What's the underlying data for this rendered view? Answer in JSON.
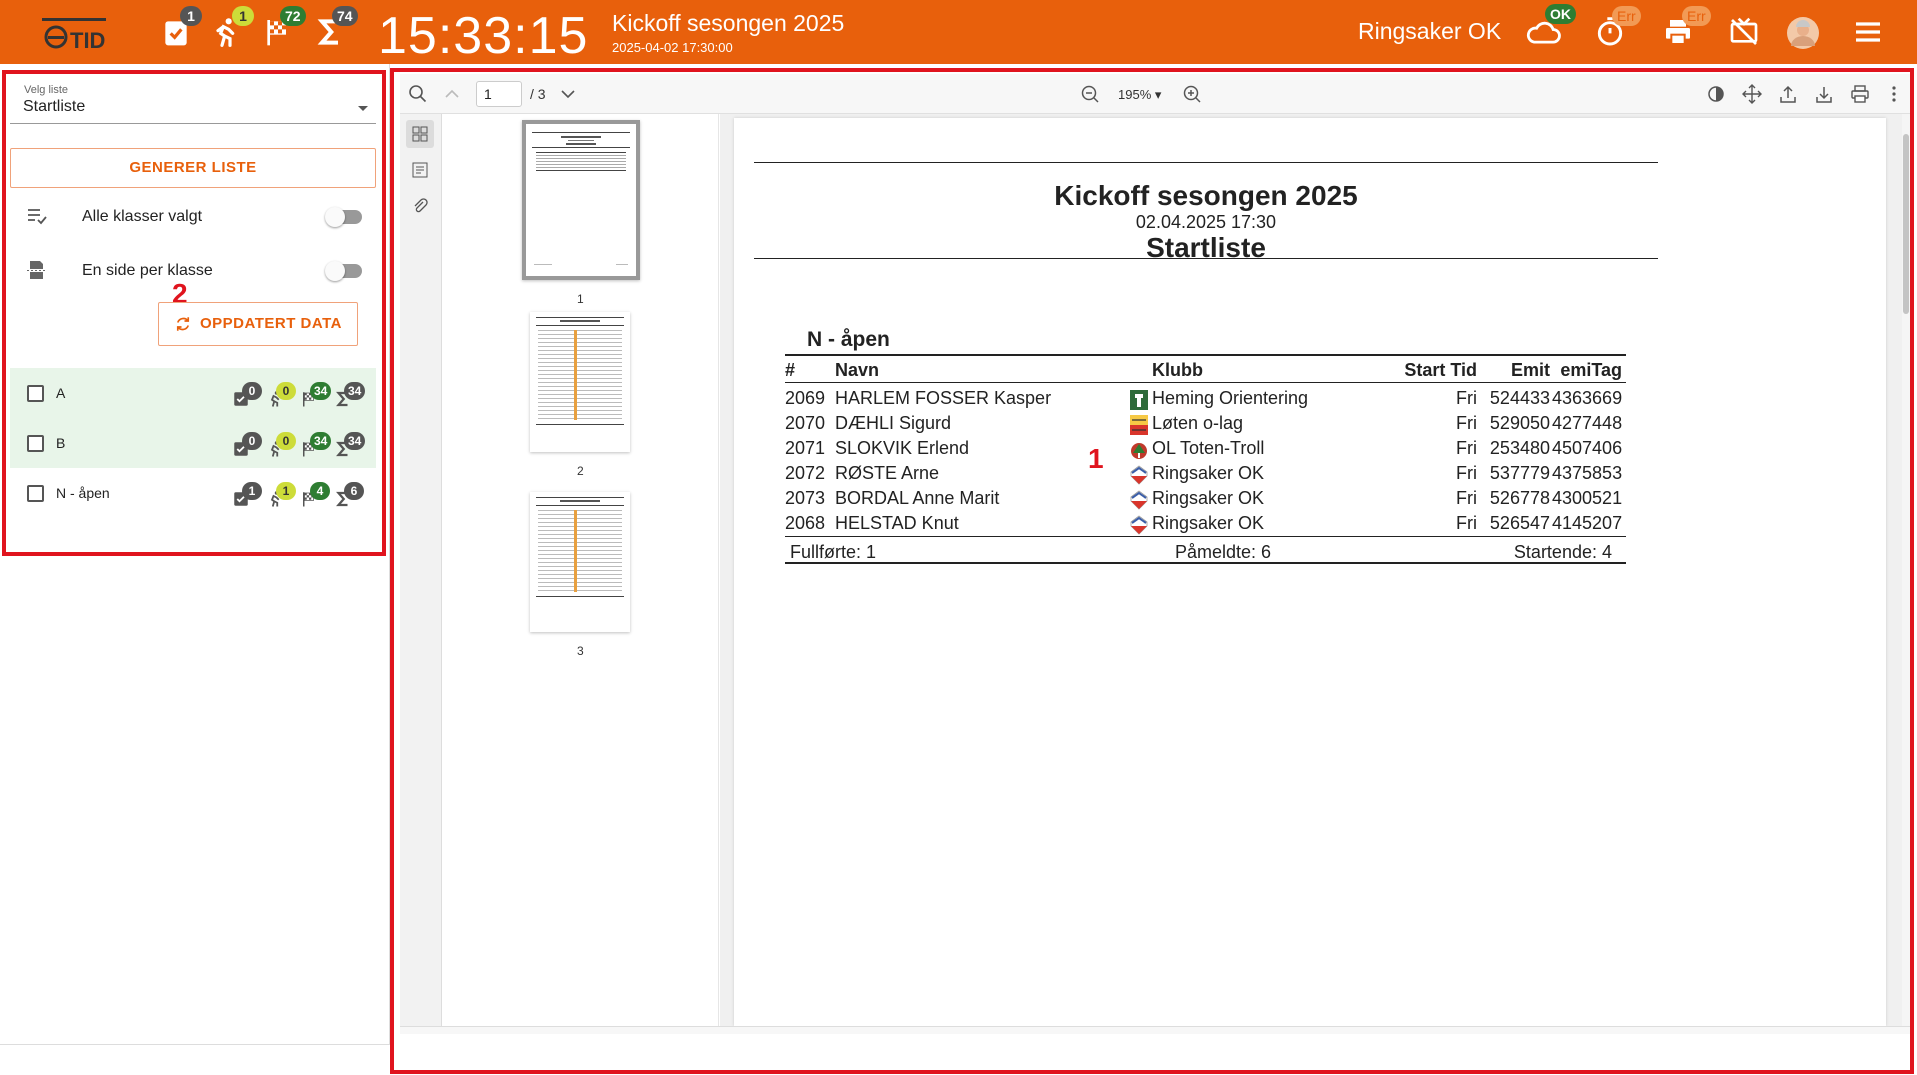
{
  "topbar": {
    "logo_text": "OTID",
    "badges": {
      "checked": "1",
      "running": "1",
      "finished": "72",
      "total": "74"
    },
    "clock": "15:33:15",
    "event_title": "Kickoff sesongen 2025",
    "event_datetime": "2025-04-02 17:30:00",
    "club": "Ringsaker OK",
    "cloud_status": "OK",
    "timer_status": "Err",
    "printer_status": "Err",
    "colors": {
      "bar": "#e8600c",
      "ok": "#2e7d32"
    }
  },
  "left": {
    "select_label": "Velg liste",
    "select_value": "Startliste",
    "generate_button": "GENERER LISTE",
    "toggle_all_classes": "Alle klasser valgt",
    "toggle_page_per_class": "En side per klasse",
    "update_button": "OPPDATERT DATA",
    "annotation": "2",
    "classes": [
      {
        "name": "A",
        "checked": "0",
        "running": "0",
        "finished": "34",
        "total": "34"
      },
      {
        "name": "B",
        "checked": "0",
        "running": "0",
        "finished": "34",
        "total": "34"
      },
      {
        "name": "N - åpen",
        "checked": "1",
        "running": "1",
        "finished": "4",
        "total": "6"
      }
    ]
  },
  "viewer": {
    "page_input": "1",
    "page_count": "/ 3",
    "zoom": "195% ▾",
    "thumb_labels": [
      "1",
      "2",
      "3"
    ],
    "annotation": "1"
  },
  "document": {
    "title": "Kickoff sesongen 2025",
    "datetime": "02.04.2025 17:30",
    "list_name": "Startliste",
    "class_name": "N - åpen",
    "headers": {
      "num": "#",
      "name": "Navn",
      "club": "Klubb",
      "start": "Start Tid",
      "emit": "Emit",
      "emitag": "emiTag"
    },
    "rows": [
      {
        "num": "2069",
        "name": "HARLEM FOSSER  Kasper",
        "club": "Heming Orientering",
        "start": "Fri",
        "emit": "524433",
        "emitag": "4363669",
        "logo": "heming-logo"
      },
      {
        "num": "2070",
        "name": "DÆHLI  Sigurd",
        "club": "Løten o-lag",
        "start": "Fri",
        "emit": "529050",
        "emitag": "4277448",
        "logo": "loten-logo"
      },
      {
        "num": "2071",
        "name": "SLOKVIK  Erlend",
        "club": "OL Toten-Troll",
        "start": "Fri",
        "emit": "253480",
        "emitag": "4507406",
        "logo": "toten-logo"
      },
      {
        "num": "2072",
        "name": "RØSTE  Arne",
        "club": "Ringsaker OK",
        "start": "Fri",
        "emit": "537779",
        "emitag": "4375853",
        "logo": "ringsaker-logo"
      },
      {
        "num": "2073",
        "name": "BORDAL  Anne Marit",
        "club": "Ringsaker OK",
        "start": "Fri",
        "emit": "526778",
        "emitag": "4300521",
        "logo": "ringsaker-logo"
      },
      {
        "num": "2068",
        "name": "HELSTAD  Knut",
        "club": "Ringsaker OK",
        "start": "Fri",
        "emit": "526547",
        "emitag": "4145207",
        "logo": "ringsaker-logo"
      }
    ],
    "footer": {
      "finished": "Fullførte: 1",
      "registered": "Påmeldte: 6",
      "starting": "Startende: 4"
    }
  }
}
